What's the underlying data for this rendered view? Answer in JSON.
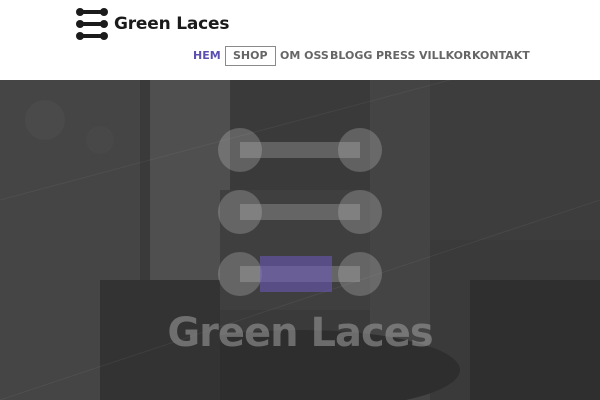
{
  "brand": {
    "name": "Green Laces",
    "logo_icon": "shoelace-logo-icon"
  },
  "nav": {
    "items": [
      {
        "label": "HEM",
        "state": "active"
      },
      {
        "label": "SHOP",
        "state": "boxed"
      },
      {
        "label": "OM OSS",
        "state": "normal"
      },
      {
        "label": "BLOGG",
        "state": "normal"
      },
      {
        "label": "PRESS",
        "state": "normal"
      },
      {
        "label": "VILLKOR",
        "state": "normal"
      },
      {
        "label": "KONTAKT",
        "state": "normal"
      }
    ]
  },
  "hero": {
    "emblem_icon": "shoelace-emblem-icon",
    "title": "Green Laces"
  },
  "colors": {
    "active_nav": "#5b4fb0",
    "nav_text": "#666666",
    "hero_button": "#6e5abe",
    "logo": "#1b1b1b"
  }
}
